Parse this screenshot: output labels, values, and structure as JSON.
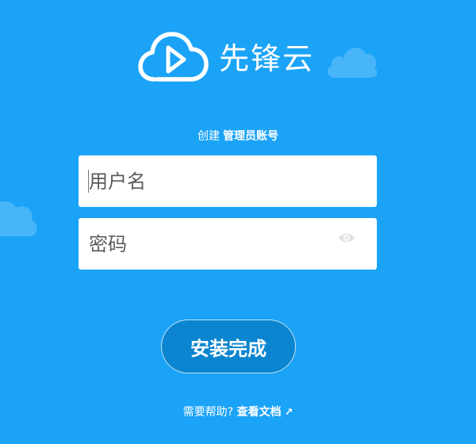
{
  "brand": {
    "name": "先锋云",
    "logo_icon": "cloud-play-icon",
    "decorations": [
      "cloud-shape",
      "cloud-shape"
    ]
  },
  "form": {
    "heading_prefix": "创建",
    "heading_strong": "管理员账号",
    "username_placeholder": "用户名",
    "password_placeholder": "密码",
    "password_toggle_icon": "eye-icon",
    "submit_label": "安装完成"
  },
  "help": {
    "prefix": "需要帮助?",
    "link_label": "查看文档",
    "link_icon": "external-arrow-icon",
    "link_arrow": "↗"
  },
  "colors": {
    "background": "#1ba3f7",
    "button": "#0b85cf",
    "text": "#ffffff",
    "field_bg": "#ffffff"
  }
}
